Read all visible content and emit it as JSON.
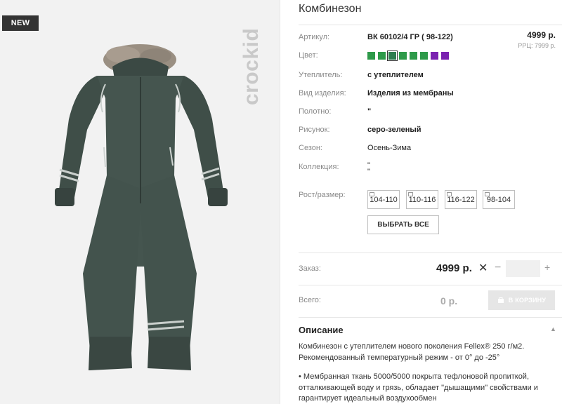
{
  "badge": "NEW",
  "brand": "crockid",
  "product": {
    "title": "Комбинезон",
    "price": "4999 р.",
    "rrp": "РРЦ: 7999 р."
  },
  "specs": [
    {
      "label": "Артикул:",
      "value": "ВК 60102/4 ГР ( 98-122)"
    },
    {
      "label": "Цвет:",
      "value": ""
    },
    {
      "label": "Утеплитель:",
      "value": "с утеплителем"
    },
    {
      "label": "Вид изделия:",
      "value": "Изделия из мембраны"
    },
    {
      "label": "Полотно:",
      "value": "\""
    },
    {
      "label": "Рисунок:",
      "value": "серо-зеленый"
    },
    {
      "label": "Сезон:",
      "value": "Осень-Зима"
    },
    {
      "label": "Коллекция:",
      "value": "\""
    },
    {
      "label": "Рост/размер:",
      "value": ""
    }
  ],
  "collection_extra": "\"",
  "colors": [
    "#2e9a4a",
    "#2e9a4a",
    "#2e7d4f",
    "#2e9a4a",
    "#2e9a4a",
    "#2e9a4a",
    "#7a22b0",
    "#7a22b0"
  ],
  "sizes": [
    "104-110",
    "110-116",
    "116-122",
    "98-104"
  ],
  "select_all": "ВЫБРАТЬ ВСЕ",
  "order": {
    "label": "Заказ:",
    "price": "4999 р.",
    "remove": "✕",
    "minus": "−",
    "plus": "+",
    "qty": ""
  },
  "total": {
    "label": "Всего:",
    "value": "0 р.",
    "cart_button": "В КОРЗИНУ"
  },
  "description": {
    "heading": "Описание",
    "para1": "Комбинезон с утеплителем нового поколения Fellex® 250 г/м2. Рекомендованный температурный режим - от 0° до -25°",
    "para2": "• Мембранная ткань 5000/5000 покрыта тефлоновой пропиткой, отталкивающей воду и грязь, обладает \"дышащими\" свойствами и гарантирует идеальный воздухообмен"
  }
}
